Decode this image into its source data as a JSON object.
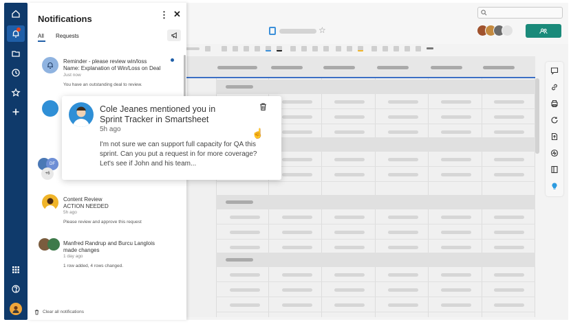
{
  "panel": {
    "title": "Notifications",
    "tabs": [
      "All",
      "Requests"
    ],
    "clear_label": "Clear all notifications"
  },
  "notifications": [
    {
      "title_line1": "Reminder - please review win/loss",
      "title_line2": "Name: Explanation of Win/Loss on Deal",
      "time": "Just now",
      "body": "You have an outstanding deal to review.",
      "unread": true
    },
    {
      "avatar_badge": "+6",
      "avatar_initials": "DF"
    },
    {
      "title_line1": "Content Review",
      "title_line2": "ACTION NEEDED",
      "time": "5h ago",
      "body": "Please review and approve this request"
    },
    {
      "title_line1": "Manfred Randrup and Burcu Langlois",
      "title_line2": "made changes",
      "time": "1 day ago",
      "body": "1 row added, 4 rows changed."
    }
  ],
  "popover": {
    "title": "Cole Jeanes mentioned you in Sprint Tracker in Smartsheet",
    "time": "5h ago",
    "body": "I'm not sure we can support full capacity for QA this sprint. Can you put a request in for more coverage? Let's see if John and his team..."
  },
  "colors": {
    "rail": "#0f3a6b",
    "rail_active": "#1f5fa8",
    "accent": "#1f5fa8",
    "share_button": "#1a8a7a",
    "badge": "#e3421f"
  },
  "icons": {
    "rail": [
      "home-icon",
      "bell-icon",
      "folder-icon",
      "clock-icon",
      "star-icon",
      "plus-icon",
      "apps-grid-icon",
      "help-icon"
    ],
    "right_tools": [
      "comment-icon",
      "link-icon",
      "print-icon",
      "refresh-icon",
      "upload-icon",
      "activity-icon",
      "panel-icon",
      "lightbulb-icon"
    ]
  }
}
